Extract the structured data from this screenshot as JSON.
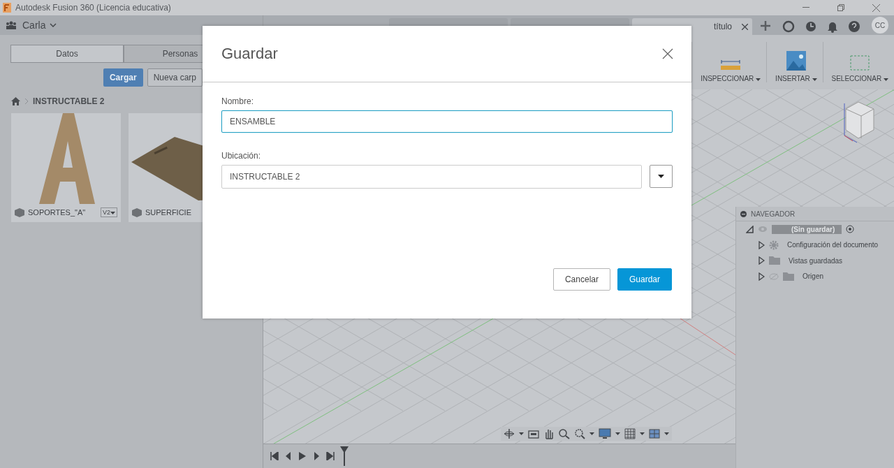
{
  "window": {
    "title": "Autodesk Fusion 360 (Licencia educativa)"
  },
  "user_menu": {
    "label": "Carla"
  },
  "data_panel": {
    "tabs": [
      {
        "label": "Datos",
        "selected": true
      },
      {
        "label": "Personas",
        "selected": false
      }
    ],
    "upload_button": "Cargar",
    "new_folder_button": "Nueva carp",
    "breadcrumb": "INSTRUCTABLE 2",
    "files": [
      {
        "name": "SOPORTES_\"A\"",
        "version": "V2",
        "kind": "letter"
      },
      {
        "name": "SUPERFICIE",
        "kind": "plate"
      }
    ]
  },
  "document_tabs": [
    {
      "selected": false
    },
    {
      "selected": false
    },
    {
      "label": "título",
      "selected": true
    }
  ],
  "avatar": "CC",
  "toolbar": [
    {
      "label": "INSPECCIONAR",
      "kind": "measure"
    },
    {
      "label": "INSERTAR",
      "kind": "image"
    },
    {
      "label": "SELECCIONAR",
      "kind": "select"
    }
  ],
  "browser": {
    "title": "NAVEGADOR",
    "root": {
      "label": "(Sin guardar)",
      "children": [
        {
          "label": "Configuración del documento",
          "kind": "settings"
        },
        {
          "label": "Vistas guardadas",
          "kind": "folder"
        },
        {
          "label": "Origen",
          "kind": "origin"
        }
      ]
    }
  },
  "dialog": {
    "title": "Guardar",
    "name_label": "Nombre:",
    "name_value": "ENSAMBLE",
    "location_label": "Ubicación:",
    "location_value": "INSTRUCTABLE 2",
    "buttons": [
      {
        "label": "Cancelar",
        "kind": "secondary"
      },
      {
        "label": "Guardar",
        "kind": "primary"
      }
    ]
  }
}
